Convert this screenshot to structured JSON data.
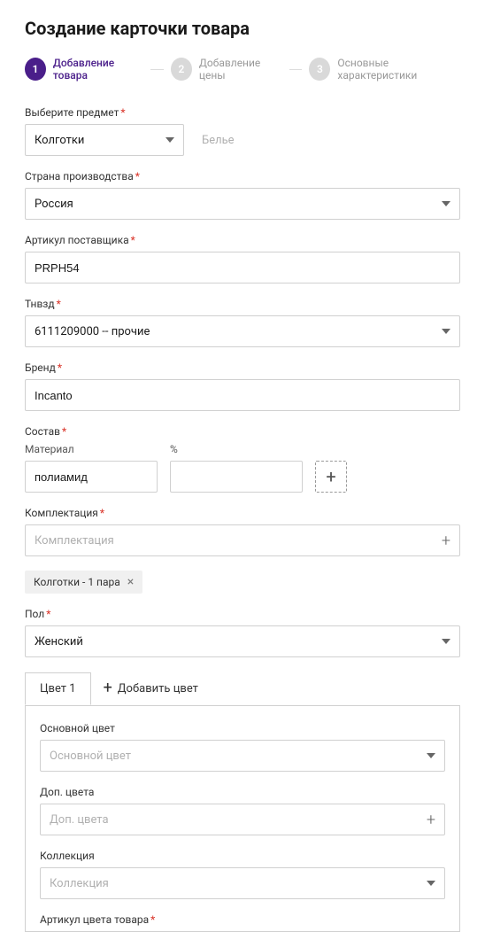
{
  "title": "Создание карточки товара",
  "steps": [
    {
      "num": "1",
      "label": "Добавление товара",
      "active": true
    },
    {
      "num": "2",
      "label": "Добавление цены",
      "active": false
    },
    {
      "num": "3",
      "label": "Основные характеристики",
      "active": false
    }
  ],
  "subject": {
    "label": "Выберите предмет",
    "value": "Колготки",
    "hint": "Белье"
  },
  "country": {
    "label": "Страна производства",
    "value": "Россия"
  },
  "sku": {
    "label": "Артикул поставщика",
    "value": "PRPH54"
  },
  "tnved": {
    "label": "Тнвзд",
    "value": "6111209000 -- прочие"
  },
  "brand": {
    "label": "Бренд",
    "value": "Incanto"
  },
  "composition": {
    "label": "Состав",
    "materialLabel": "Материал",
    "percentLabel": "%",
    "materialValue": "полиамид",
    "percentValue": ""
  },
  "kit": {
    "label": "Комплектация",
    "placeholder": "Комплектация"
  },
  "tag": "Колготки - 1 пара",
  "gender": {
    "label": "Пол",
    "value": "Женский"
  },
  "colorTab": "Цвет 1",
  "addColor": "Добавить цвет",
  "mainColor": {
    "label": "Основной цвет",
    "placeholder": "Основной цвет"
  },
  "addColors": {
    "label": "Доп. цвета",
    "placeholder": "Доп. цвета"
  },
  "collection": {
    "label": "Коллекция",
    "placeholder": "Коллекция"
  },
  "colorSku": {
    "label": "Артикул цвета товара"
  }
}
